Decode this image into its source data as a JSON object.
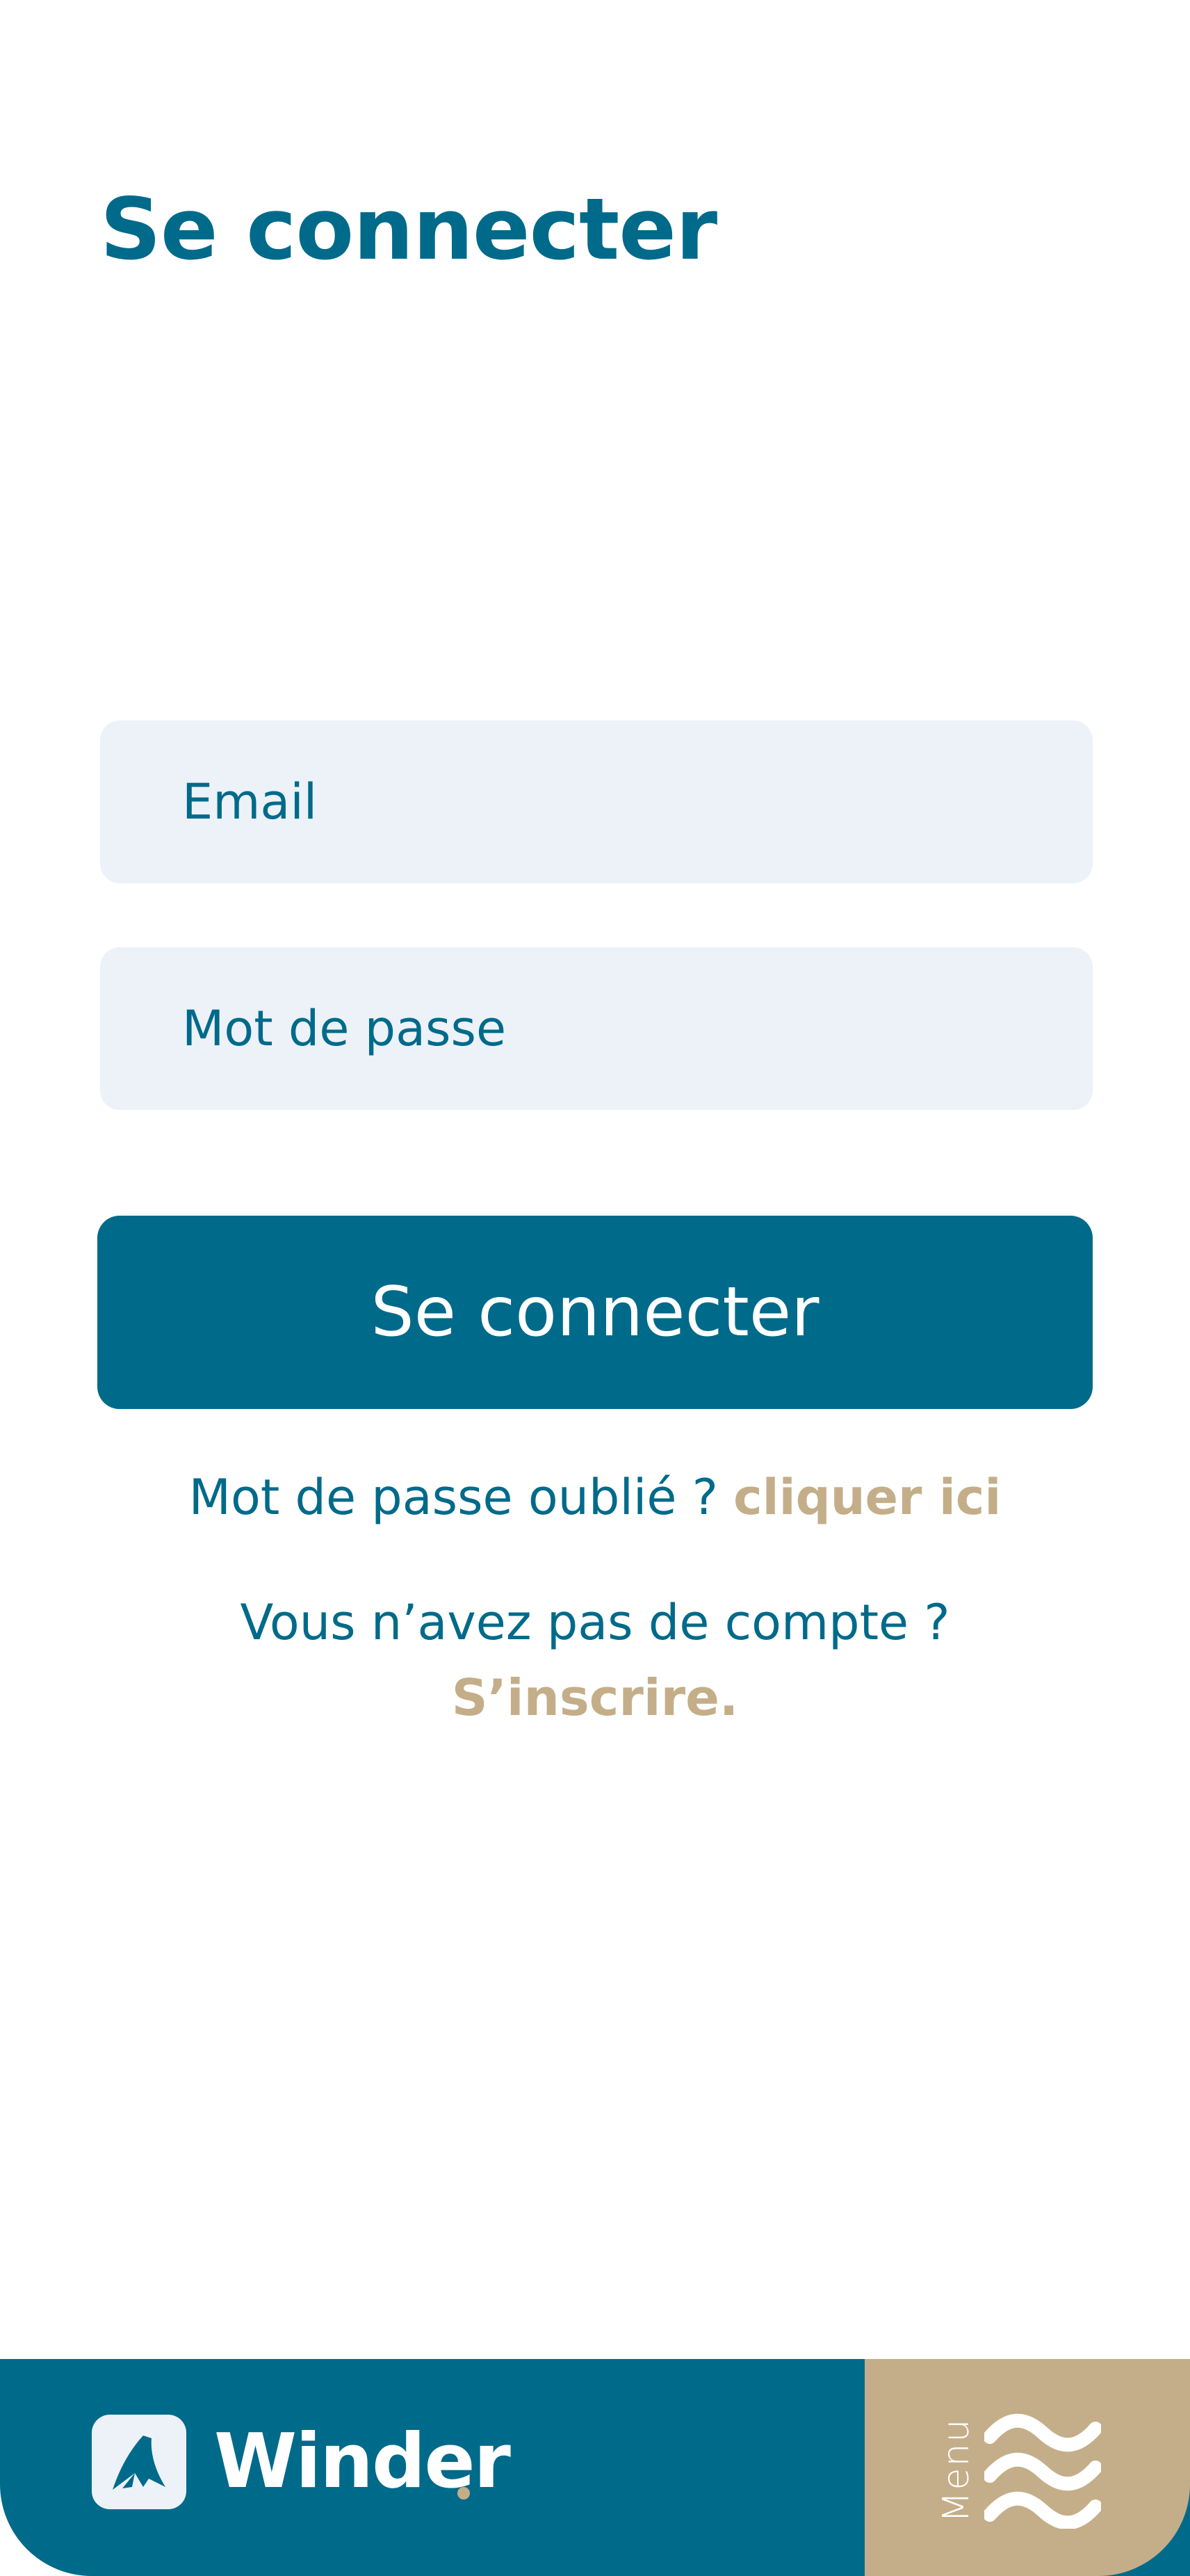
{
  "login": {
    "title": "Se connecter",
    "email_placeholder": "Email",
    "password_placeholder": "Mot de passe",
    "submit_label": "Se connecter",
    "forgot_text": "Mot de passe oublié ?",
    "forgot_link": "cliquer ici",
    "no_account_text": "Vous n’avez pas de compte ?",
    "signup_link": "S’inscrire."
  },
  "footer": {
    "brand_name": "Winder",
    "menu_label": "Menu",
    "logo_icon": "sail-icon",
    "menu_icon": "waves-icon"
  },
  "colors": {
    "primary": "#006a8a",
    "accent": "#c4ae89",
    "input_bg": "#ecf2f8",
    "background": "#ffffff"
  }
}
